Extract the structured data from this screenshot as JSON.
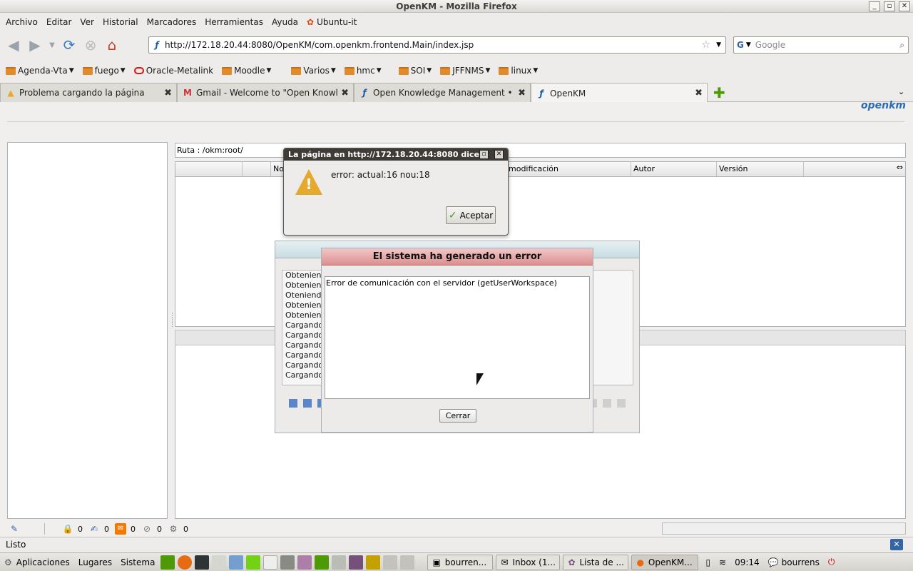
{
  "window": {
    "title": "OpenKM - Mozilla Firefox"
  },
  "menubar": {
    "items": [
      "Archivo",
      "Editar",
      "Ver",
      "Historial",
      "Marcadores",
      "Herramientas",
      "Ayuda",
      "Ubuntu-it"
    ]
  },
  "navbar": {
    "url": "http://172.18.20.44:8080/OpenKM/com.openkm.frontend.Main/index.jsp",
    "search_placeholder": "Google"
  },
  "bookmarks": {
    "items": [
      "Agenda-Vta",
      "fuego",
      "Oracle-Metalink",
      "Moodle",
      "Varios",
      "hmc",
      "SOI",
      "JFFNMS",
      "linux"
    ]
  },
  "tabs": [
    {
      "label": "Problema cargando la página",
      "icon": "warning-icon"
    },
    {
      "label": "Gmail - Welcome to \"Open Knowl...",
      "icon": "gmail-icon"
    },
    {
      "label": "Open Knowledge Management • ...",
      "icon": "openkm-icon"
    },
    {
      "label": "OpenKM",
      "icon": "openkm-icon"
    }
  ],
  "openkm": {
    "logo": "openkm",
    "path": "Ruta : /okm:root/",
    "columns": [
      "No",
      "modificación",
      "Autor",
      "Versión"
    ],
    "status_counts": [
      "0",
      "0",
      "0",
      "0",
      "0"
    ]
  },
  "loading_dialog": {
    "lines": [
      "Obteniend",
      "Obteniend",
      "Oteniendo",
      "Obteniend",
      "Obteniend",
      "Cargando",
      "Cargando",
      "Cargando",
      "Cargando",
      "Cargando",
      "Cargando"
    ]
  },
  "error_dialog": {
    "title": "El sistema ha generado un error",
    "message": "Error de comunicación con el servidor (getUserWorkspace)",
    "close_label": "Cerrar"
  },
  "alert_dialog": {
    "title": "La página en http://172.18.20.44:8080 dice:",
    "message": "error: actual:16 nou:18",
    "ok_label": "Aceptar"
  },
  "firefox_status": "Listo",
  "taskbar": {
    "menus": [
      "Aplicaciones",
      "Lugares",
      "Sistema"
    ],
    "windows": [
      "bourren...",
      "Inbox (1...",
      "Lista de ...",
      "OpenKM..."
    ],
    "time": "09:14",
    "user": "bourrens"
  }
}
